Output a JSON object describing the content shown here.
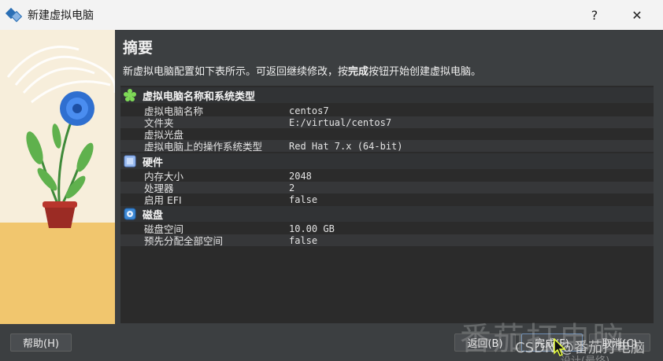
{
  "window": {
    "title": "新建虚拟电脑",
    "help_glyph": "?",
    "close_glyph": "✕",
    "icon": "virtualbox-icon"
  },
  "page": {
    "heading": "摘要",
    "description_before": "新虚拟电脑配置如下表所示。可返回继续修改，按",
    "description_bold": "完成",
    "description_after": "按钮开始创建虚拟电脑。"
  },
  "sections": {
    "general": {
      "title": "虚拟电脑名称和系统类型",
      "icon": "green-gear-icon",
      "rows": [
        {
          "key": "虚拟电脑名称",
          "value": "centos7"
        },
        {
          "key": "文件夹",
          "value": "E:/virtual/centos7"
        },
        {
          "key": "虚拟光盘",
          "value": ""
        },
        {
          "key": "虚拟电脑上的操作系统类型",
          "value": "Red Hat 7.x (64-bit)"
        }
      ]
    },
    "hardware": {
      "title": "硬件",
      "icon": "hardware-chip-icon",
      "rows": [
        {
          "key": "内存大小",
          "value": "2048"
        },
        {
          "key": "处理器",
          "value": "2"
        },
        {
          "key": "启用 EFI",
          "value": "false"
        }
      ]
    },
    "disk": {
      "title": "磁盘",
      "icon": "hard-disk-icon",
      "rows": [
        {
          "key": "磁盘空间",
          "value": "10.00 GB"
        },
        {
          "key": "预先分配全部空间",
          "value": "false"
        }
      ]
    }
  },
  "buttons": {
    "help": "帮助(H)",
    "back": "返回(B)",
    "finish": "完成(F)",
    "cancel": "取消(C)"
  },
  "overlay": {
    "watermark": "番茄打电脑",
    "watermark_small": "CSDN @番茄打电脑",
    "watermark_tiny": "设计(最终)"
  },
  "colors": {
    "background": "#3c3f41",
    "table_background": "#2b2b2b",
    "section_header": "#313335",
    "titlebar": "#f3f3f3"
  }
}
